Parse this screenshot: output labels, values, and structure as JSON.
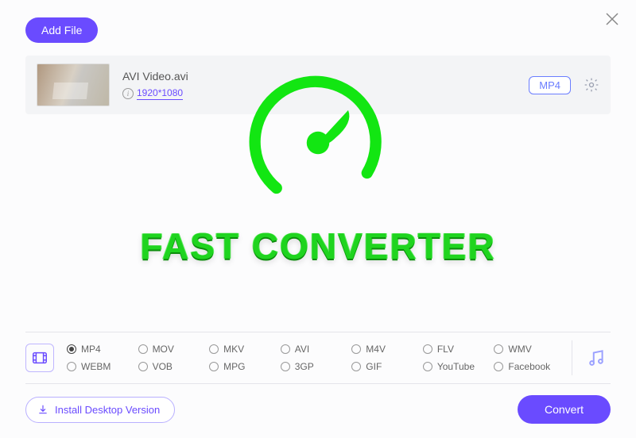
{
  "header": {
    "add_file_label": "Add File"
  },
  "file": {
    "name": "AVI Video.avi",
    "resolution": "1920*1080",
    "output_badge": "MP4"
  },
  "overlay": {
    "title": "FAST CONVERTER"
  },
  "formats": {
    "selected": "MP4",
    "row1": [
      "MP4",
      "MOV",
      "MKV",
      "AVI",
      "M4V",
      "FLV",
      "WMV"
    ],
    "row2": [
      "WEBM",
      "VOB",
      "MPG",
      "3GP",
      "GIF",
      "YouTube",
      "Facebook"
    ]
  },
  "footer": {
    "install_label": "Install Desktop Version",
    "convert_label": "Convert"
  },
  "colors": {
    "accent": "#6a4bff",
    "overlay_green": "#1fd41f"
  }
}
